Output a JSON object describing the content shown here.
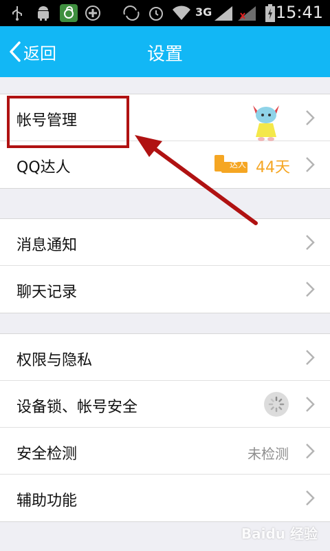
{
  "status_bar": {
    "time": "15:41",
    "network": "3G",
    "icons": [
      "usb-icon",
      "android-icon",
      "app-icon",
      "add-icon",
      "sync-icon",
      "alarm-icon",
      "wifi-icon",
      "signal-icon",
      "battery-icon"
    ]
  },
  "nav": {
    "back_label": "返回",
    "title": "设置"
  },
  "groups": [
    {
      "items": [
        {
          "label": "帐号管理",
          "accessory": "avatar"
        },
        {
          "label": "QQ达人",
          "badge_text": "达人",
          "value": "44天"
        }
      ]
    },
    {
      "items": [
        {
          "label": "消息通知"
        },
        {
          "label": "聊天记录"
        }
      ]
    },
    {
      "items": [
        {
          "label": "权限与隐私"
        },
        {
          "label": "设备锁、帐号安全",
          "accessory": "spinner"
        },
        {
          "label": "安全检测",
          "value": "未检测"
        },
        {
          "label": "辅助功能"
        }
      ]
    }
  ],
  "colors": {
    "accent": "#12b7f5",
    "annotation": "#b01212",
    "daren_orange": "#f5a623"
  },
  "watermark": "Baidu 经验"
}
